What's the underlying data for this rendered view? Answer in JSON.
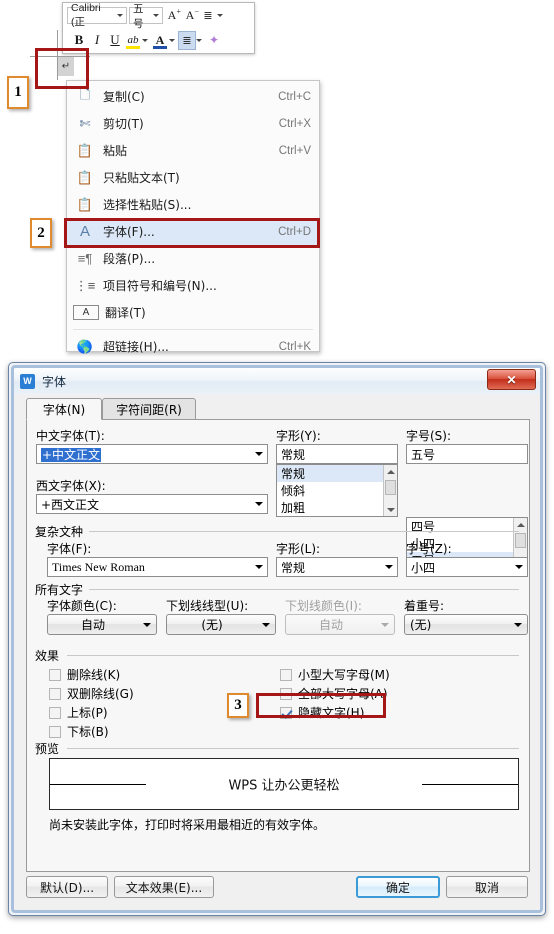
{
  "mini_toolbar": {
    "font_name": "Calibri (正",
    "font_size": "五号",
    "grow_font": "A",
    "shrink_font": "A",
    "line_spacing_icon": "line-spacing-icon",
    "bold": "B",
    "italic": "I",
    "underline": "U",
    "highlight": "ab",
    "font_color": "A",
    "align": "align-icon",
    "format_painter": "format-painter-icon"
  },
  "document": {
    "paragraph_mark": "↵"
  },
  "context_menu": {
    "items": [
      {
        "icon": "copy-icon",
        "glyph": "❐",
        "label": "复制(C)",
        "shortcut": "Ctrl+C",
        "selected": false
      },
      {
        "icon": "cut-icon",
        "glyph": "✂",
        "label": "剪切(T)",
        "shortcut": "Ctrl+X",
        "selected": false
      },
      {
        "icon": "paste-icon",
        "glyph": "ὌB",
        "label": "粘贴",
        "shortcut": "Ctrl+V",
        "selected": false
      },
      {
        "icon": "paste-text-only-icon",
        "glyph": "A",
        "label": "只粘贴文本(T)",
        "shortcut": "",
        "selected": false
      },
      {
        "icon": "paste-special-icon",
        "glyph": "?",
        "label": "选择性粘贴(S)...",
        "shortcut": "",
        "selected": false
      },
      {
        "icon": "font-icon",
        "glyph": "A",
        "label": "字体(F)...",
        "shortcut": "Ctrl+D",
        "selected": true
      },
      {
        "icon": "paragraph-icon",
        "glyph": "¶",
        "label": "段落(P)...",
        "shortcut": "",
        "selected": false
      },
      {
        "icon": "bullets-numbering-icon",
        "glyph": "≡",
        "label": "项目符号和编号(N)...",
        "shortcut": "",
        "selected": false
      },
      {
        "icon": "translate-icon",
        "glyph": "A",
        "label": "翻译(T)",
        "shortcut": "",
        "selected": false
      },
      {
        "icon": "hyperlink-icon",
        "glyph": "ἱ0",
        "label": "超链接(H)...",
        "shortcut": "Ctrl+K",
        "selected": false
      }
    ]
  },
  "steps": [
    {
      "number": "1"
    },
    {
      "number": "2"
    },
    {
      "number": "3"
    }
  ],
  "dialog": {
    "title": "字体",
    "logo_text": "W",
    "close_label": "✕",
    "tabs": [
      {
        "label": "字体(N)",
        "active": true
      },
      {
        "label": "字符间距(R)",
        "active": false
      }
    ],
    "chinese_font": {
      "label": "中文字体(T):",
      "value": "+中文正文"
    },
    "western_font": {
      "label": "西文字体(X):",
      "value": "+西文正文"
    },
    "font_style": {
      "label": "字形(Y):",
      "value": "常规",
      "options": [
        "常规",
        "倾斜",
        "加粗"
      ],
      "selected_index": 0
    },
    "font_size": {
      "label": "字号(S):",
      "value": "五号",
      "options": [
        "四号",
        "小四",
        "五号"
      ],
      "selected_index": 2
    },
    "complex_script": {
      "group_label": "复杂文种",
      "font": {
        "label": "字体(F):",
        "value": "Times New Roman"
      },
      "style": {
        "label": "字形(L):",
        "value": "常规"
      },
      "size": {
        "label": "字号(Z):",
        "value": "小四"
      }
    },
    "all_text": {
      "group_label": "所有文字",
      "font_color": {
        "label": "字体颜色(C):",
        "value": "自动",
        "disabled": false
      },
      "underline_style": {
        "label": "下划线线型(U):",
        "value": "(无)",
        "disabled": false
      },
      "underline_color": {
        "label": "下划线颜色(I):",
        "value": "自动",
        "disabled": true
      },
      "emphasis_mark": {
        "label": "着重号:",
        "value": "(无)",
        "disabled": false
      }
    },
    "effects": {
      "group_label": "效果",
      "left_column": [
        {
          "label": "删除线(K)",
          "checked": false
        },
        {
          "label": "双删除线(G)",
          "checked": false
        },
        {
          "label": "上标(P)",
          "checked": false
        },
        {
          "label": "下标(B)",
          "checked": false
        }
      ],
      "right_column": [
        {
          "label": "小型大写字母(M)",
          "checked": false
        },
        {
          "label": "全部大写字母(A)",
          "checked": false
        },
        {
          "label": "隐藏文字(H)",
          "checked": true
        }
      ]
    },
    "preview": {
      "group_label": "预览",
      "sample_text": "WPS 让办公更轻松",
      "note": "尚未安装此字体，打印时将采用最相近的有效字体。"
    },
    "buttons": {
      "default": "默认(D)...",
      "text_effects": "文本效果(E)...",
      "ok": "确定",
      "cancel": "取消"
    }
  },
  "colors": {
    "highlight_rect": "#a51717",
    "step_badge_border": "#e08a2e",
    "menu_selection": "#dce8f7",
    "dialog_bg": "#f0f0f0",
    "accent_blue": "#2f6fd0",
    "close_red": "#c22f1b"
  }
}
